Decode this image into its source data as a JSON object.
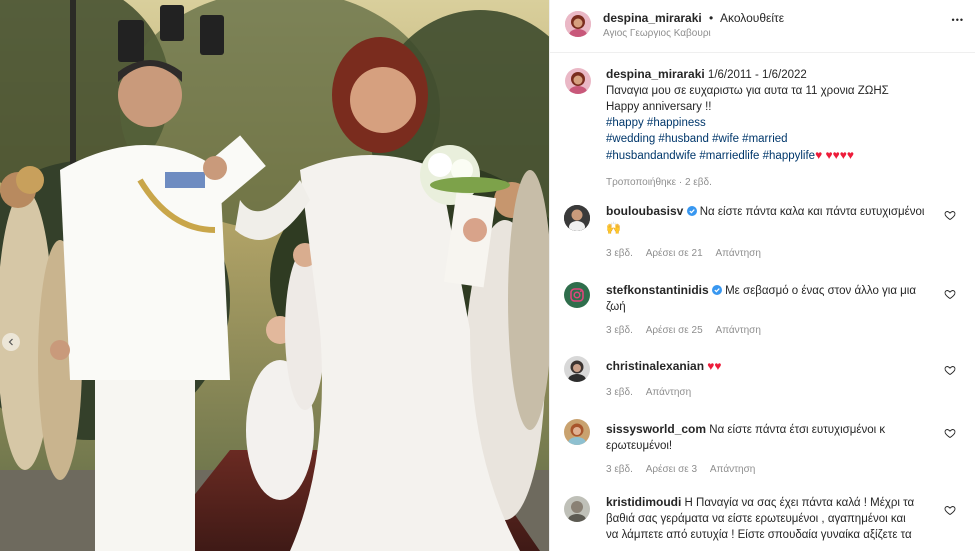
{
  "post": {
    "username": "despina_miraraki",
    "separator": "•",
    "follow_label": "Ακολουθείτε",
    "location": "Αγιος Γεωργιος Καβουρι",
    "more_label": "•••"
  },
  "caption": {
    "username": "despina_miraraki",
    "dates": "1/6/2011 - 1/6/2022",
    "line1_rest": "Παναγια μου σε ευχαριστω για αυτα τα 11 χρονια ΖΩΗΣ",
    "line2": "Happy anniversary !!",
    "line3": "#happy #happiness",
    "line4": "#wedding #husband #wife #married",
    "line5": "#husbandandwife #marriedlife #happylife",
    "line5_hearts": "♥ ♥♥♥♥",
    "edited": "Τροποποιήθηκε · 2 εβδ."
  },
  "comments": [
    {
      "username": "bouloubasisv",
      "verified": true,
      "line1": "Να είστε πάντα καλα και πάντα ευτυχισμένοι",
      "line2": "🙌",
      "time": "3 εβδ.",
      "likes": "Αρέσει σε 21",
      "reply": "Απάντηση"
    },
    {
      "username": "stefkonstantinidis",
      "verified": true,
      "line1": "Με σεβασμό ο ένας στον άλλο για μια",
      "line2": "ζωή",
      "time": "3 εβδ.",
      "likes": "Αρέσει σε 25",
      "reply": "Απάντηση"
    },
    {
      "username": "christinalexanian",
      "verified": false,
      "line1": "♥♥",
      "line2": "",
      "time": "3 εβδ.",
      "likes": "",
      "reply": "Απάντηση"
    },
    {
      "username": "sissysworld_com",
      "verified": false,
      "line1": "Να είστε πάντα έτσι ευτυχισμένοι κ",
      "line2": "ερωτευμένοι!",
      "time": "3 εβδ.",
      "likes": "Αρέσει σε 3",
      "reply": "Απάντηση"
    },
    {
      "username": "kristidimoudi",
      "verified": false,
      "line1": "Η Παναγία να σας έχει πάντα καλά ! Μέχρι τα",
      "line2": "βαθιά σας γεράματα να είστε ερωτευμένοι , αγαπημένοι και",
      "line3": "να λάμπετε από ευτυχία ! Είστε σπουδαία γυναίκα αξίζετε τα",
      "time": "",
      "likes": "",
      "reply": ""
    }
  ],
  "colors": {
    "link": "#00376b",
    "muted": "#8e8e8e",
    "heart": "#ed1c3a",
    "verified": "#3897f0"
  }
}
